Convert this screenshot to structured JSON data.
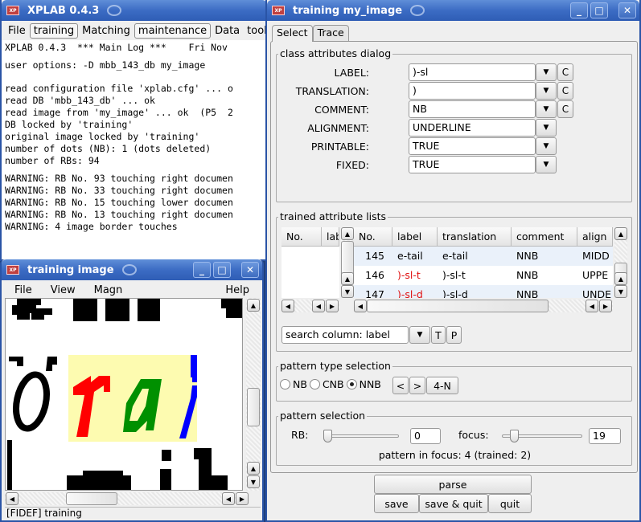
{
  "log_window": {
    "title": "XPLAB 0.4.3",
    "menu": [
      {
        "label": "File",
        "boxed": false
      },
      {
        "label": "training",
        "boxed": true
      },
      {
        "label": "Matching",
        "boxed": false
      },
      {
        "label": "maintenance",
        "boxed": true
      },
      {
        "label": "Data",
        "boxed": false
      },
      {
        "label": "tooll",
        "boxed": false
      }
    ],
    "lines": [
      "XPLAB 0.4.3  *** Main Log ***    Fri Nov",
      "",
      "user options: -D mbb_143_db my_image",
      "",
      "",
      "read configuration file 'xplab.cfg' ... o",
      "read DB 'mbb_143_db' ... ok",
      "read image from 'my_image' ... ok  (P5  2",
      "DB locked by 'training'",
      "original image locked by 'training'",
      "number of dots (NB): 1 (dots deleted)",
      "number of RBs: 94",
      "",
      "WARNING: RB No. 93 touching right documen",
      "WARNING: RB No. 33 touching right documen",
      "WARNING: RB No. 15 touching lower documen",
      "WARNING: RB No. 13 touching right documen",
      "WARNING: 4 image border touches"
    ]
  },
  "image_window": {
    "title": "training image",
    "menu": [
      "File",
      "View",
      "Magn"
    ],
    "help": "Help",
    "status": "[FIDEF] training",
    "highlight_color": "#fdfbb0",
    "glyph_colors": {
      "r": "#ff0000",
      "a": "#009000",
      "stroke": "#0000ff"
    }
  },
  "dialog": {
    "title": "training my_image",
    "tabs": [
      {
        "label": "Select",
        "active": true
      },
      {
        "label": "Trace",
        "active": false
      }
    ],
    "class_attributes": {
      "title": "class attributes dialog",
      "fields": [
        {
          "label": "LABEL:",
          "value": ")-sl",
          "clear": "C"
        },
        {
          "label": "TRANSLATION:",
          "value": ")",
          "clear": "C"
        },
        {
          "label": "COMMENT:",
          "value": "NB",
          "clear": "C"
        },
        {
          "label": "ALIGNMENT:",
          "value": "UNDERLINE",
          "clear": null
        },
        {
          "label": "PRINTABLE:",
          "value": "TRUE",
          "clear": null
        },
        {
          "label": "FIXED:",
          "value": "TRUE",
          "clear": null
        }
      ]
    },
    "trained_lists": {
      "title": "trained attribute lists",
      "left_columns": [
        "No.",
        "lab"
      ],
      "columns": [
        "No.",
        "label",
        "translation",
        "comment",
        "align"
      ],
      "rows": [
        {
          "no": "145",
          "label": "e-tail",
          "translation": "e-tail",
          "comment": "NNB",
          "align": "MIDD",
          "highlight": false
        },
        {
          "no": "146",
          "label": ")-sl-t",
          "translation": ")-sl-t",
          "comment": "NNB",
          "align": "UPPE",
          "highlight": true
        },
        {
          "no": "147",
          "label": ")-sl-d",
          "translation": ")-sl-d",
          "comment": "NNB",
          "align": "UNDE",
          "highlight": true
        }
      ],
      "search_value": "search column: label",
      "btn_t": "T",
      "btn_p": "P"
    },
    "pattern_type": {
      "title": "pattern type selection",
      "options": [
        {
          "label": "NB",
          "checked": false
        },
        {
          "label": "CNB",
          "checked": false
        },
        {
          "label": "NNB",
          "checked": true
        }
      ],
      "prev": "<",
      "next": ">",
      "mode": "4-N"
    },
    "pattern_selection": {
      "title": "pattern selection",
      "rb_label": "RB:",
      "rb_value": "0",
      "focus_label": "focus:",
      "focus_value": "19",
      "info": "pattern in focus: 4 (trained: 2)"
    },
    "buttons": {
      "parse": "parse",
      "save": "save",
      "save_quit": "save & quit",
      "quit": "quit"
    }
  }
}
